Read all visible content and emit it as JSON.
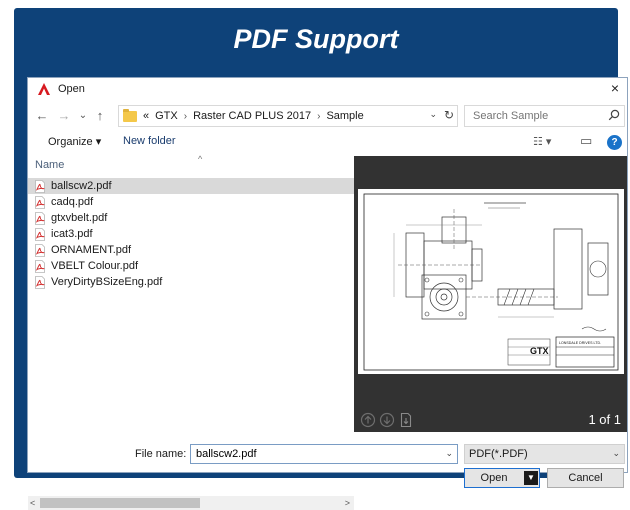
{
  "banner": {
    "title": "PDF Support"
  },
  "dialog": {
    "title": "Open",
    "close_glyph": "×"
  },
  "navigation": {
    "back_glyph": "←",
    "forward_glyph": "→",
    "history_glyph": "⌄",
    "up_glyph": "↑",
    "overflow": "«",
    "breadcrumb": [
      "GTX",
      "Raster CAD PLUS 2017",
      "Sample"
    ],
    "separator": "›",
    "dropdown_glyph": "⌄",
    "refresh_glyph": "↻"
  },
  "search": {
    "placeholder": "Search Sample"
  },
  "toolbar": {
    "organize_label": "Organize ▾",
    "new_folder_label": "New folder",
    "view_glyph": "☷ ▾",
    "pane_glyph": "▭",
    "help_glyph": "?"
  },
  "file_list": {
    "column_header": "Name",
    "sort_glyph": "^",
    "files": [
      {
        "name": "ballscw2.pdf",
        "selected": true
      },
      {
        "name": "cadq.pdf",
        "selected": false
      },
      {
        "name": "gtxvbelt.pdf",
        "selected": false
      },
      {
        "name": "icat3.pdf",
        "selected": false
      },
      {
        "name": "ORNAMENT.pdf",
        "selected": false
      },
      {
        "name": "VBELT Colour.pdf",
        "selected": false
      },
      {
        "name": "VeryDirtyBSizeEng.pdf",
        "selected": false
      }
    ],
    "scroll_left_glyph": "<",
    "scroll_right_glyph": ">"
  },
  "preview": {
    "page_indicator": "1 of 1",
    "logo_text": "GTX",
    "company_text": "LONSDALE DRIVES LTD."
  },
  "footer": {
    "filename_label": "File name:",
    "filename_value": "ballscw2.pdf",
    "filename_dd_glyph": "⌄",
    "filetype_value": "PDF(*.PDF)",
    "filetype_dd_glyph": "⌄",
    "open_label": "Open",
    "open_split_glyph": "▼",
    "cancel_label": "Cancel"
  },
  "colors": {
    "frame": "#0e4279",
    "accent": "#1e6fd0",
    "preview_bg": "#323232"
  }
}
